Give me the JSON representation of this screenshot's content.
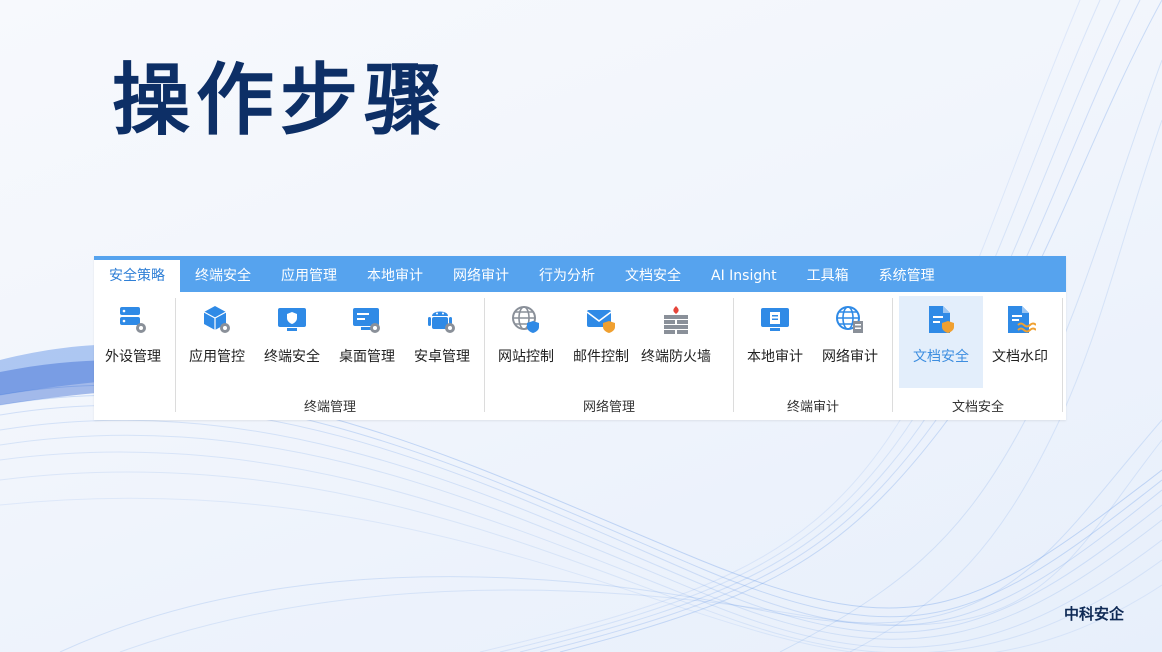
{
  "slide": {
    "title": "操作步骤",
    "brand": "中科安企"
  },
  "ribbon": {
    "tabs": [
      "安全策略",
      "终端安全",
      "应用管理",
      "本地审计",
      "网络审计",
      "行为分析",
      "文档安全",
      "AI Insight",
      "工具箱",
      "系统管理"
    ],
    "active_tab": "安全策略",
    "groups": [
      {
        "label": "",
        "buttons": [
          {
            "label": "外设管理",
            "icon": "server-gear-icon"
          }
        ]
      },
      {
        "label": "终端管理",
        "buttons": [
          {
            "label": "应用管控",
            "icon": "cube-gear-icon"
          },
          {
            "label": "终端安全",
            "icon": "monitor-shield-icon"
          },
          {
            "label": "桌面管理",
            "icon": "desktop-gear-icon"
          },
          {
            "label": "安卓管理",
            "icon": "android-gear-icon"
          }
        ]
      },
      {
        "label": "网络管理",
        "buttons": [
          {
            "label": "网站控制",
            "icon": "globe-shield-icon"
          },
          {
            "label": "邮件控制",
            "icon": "mail-shield-icon"
          },
          {
            "label": "终端防火墙",
            "icon": "firewall-icon"
          }
        ]
      },
      {
        "label": "终端审计",
        "buttons": [
          {
            "label": "本地审计",
            "icon": "monitor-doc-icon"
          },
          {
            "label": "网络审计",
            "icon": "globe-doc-icon"
          }
        ]
      },
      {
        "label": "文档安全",
        "buttons": [
          {
            "label": "文档安全",
            "icon": "document-shield-icon",
            "selected": true
          },
          {
            "label": "文档水印",
            "icon": "document-watermark-icon"
          }
        ]
      }
    ]
  },
  "colors": {
    "title": "#0d2f66",
    "tabbar": "#56a3ee",
    "active_tab_text": "#2f7fd6",
    "icon_blue": "#2f8ae6",
    "icon_gray": "#8a9099",
    "selected_bg": "#e3eefb"
  }
}
